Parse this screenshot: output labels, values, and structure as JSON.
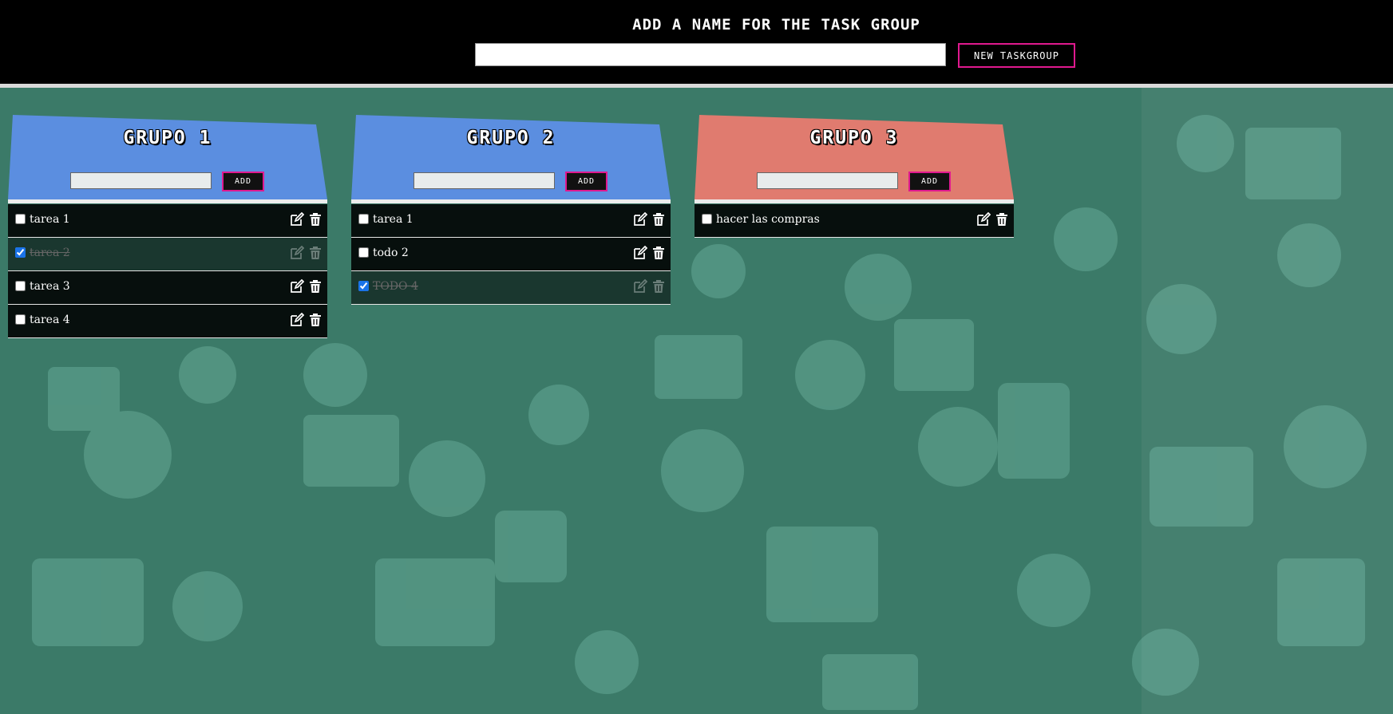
{
  "header": {
    "title": "ADD A NAME FOR THE TASK GROUP",
    "input_value": "",
    "button_label": "NEW TASKGROUP"
  },
  "colors": {
    "header_bg": "#000000",
    "accent_border": "#e0198f",
    "group_blue": "#5b8ee0",
    "group_red": "#e07b6f",
    "page_bg": "#3b7a68"
  },
  "groups": [
    {
      "title": "GRUPO 1",
      "input_value": "",
      "add_label": "ADD",
      "color": "#5b8ee0",
      "tasks": [
        {
          "text": "tarea 1",
          "done": false
        },
        {
          "text": "tarea 2",
          "done": true
        },
        {
          "text": "tarea 3",
          "done": false
        },
        {
          "text": "tarea 4",
          "done": false
        }
      ]
    },
    {
      "title": "GRUPO 2",
      "input_value": "",
      "add_label": "ADD",
      "color": "#5b8ee0",
      "tasks": [
        {
          "text": "tarea 1",
          "done": false
        },
        {
          "text": "todo 2",
          "done": false
        },
        {
          "text": "TODO 4",
          "done": true
        }
      ]
    },
    {
      "title": "GRUPO 3",
      "input_value": "",
      "add_label": "ADD",
      "color": "#e07b6f",
      "tasks": [
        {
          "text": "hacer las compras",
          "done": false
        }
      ]
    }
  ],
  "icons": {
    "edit": "edit-icon",
    "delete": "trash-icon"
  }
}
